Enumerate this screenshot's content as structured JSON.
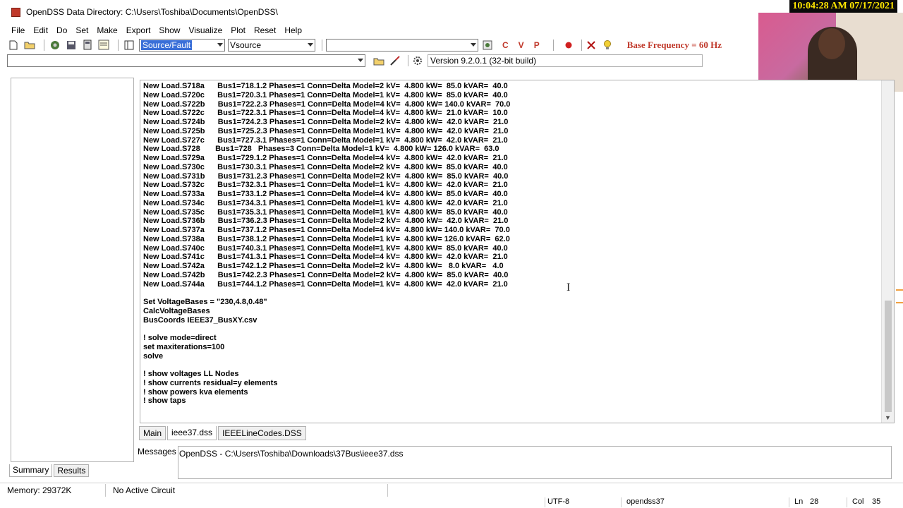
{
  "window": {
    "title": "OpenDSS Data Directory: C:\\Users\\Toshiba\\Documents\\OpenDSS\\"
  },
  "overlay": {
    "clock": "10:04:28 AM 07/17/2021"
  },
  "menu": [
    "File",
    "Edit",
    "Do",
    "Set",
    "Make",
    "Export",
    "Show",
    "Visualize",
    "Plot",
    "Reset",
    "Help"
  ],
  "toolbar": {
    "element_type": "Source/Fault",
    "element_name": "Vsource",
    "element_extra": "",
    "red_buttons": [
      "C",
      "V",
      "P"
    ],
    "base_frequency": "Base Frequency = 60 Hz",
    "command_combo": "",
    "version": "Version 9.2.0.1 (32-bit build)"
  },
  "editor": {
    "lines": [
      "New Load.S718a      Bus1=718.1.2 Phases=1 Conn=Delta Model=2 kV=  4.800 kW=  85.0 kVAR=  40.0",
      "New Load.S720c      Bus1=720.3.1 Phases=1 Conn=Delta Model=1 kV=  4.800 kW=  85.0 kVAR=  40.0",
      "New Load.S722b      Bus1=722.2.3 Phases=1 Conn=Delta Model=4 kV=  4.800 kW= 140.0 kVAR=  70.0",
      "New Load.S722c      Bus1=722.3.1 Phases=1 Conn=Delta Model=4 kV=  4.800 kW=  21.0 kVAR=  10.0",
      "New Load.S724b      Bus1=724.2.3 Phases=1 Conn=Delta Model=2 kV=  4.800 kW=  42.0 kVAR=  21.0",
      "New Load.S725b      Bus1=725.2.3 Phases=1 Conn=Delta Model=1 kV=  4.800 kW=  42.0 kVAR=  21.0",
      "New Load.S727c      Bus1=727.3.1 Phases=1 Conn=Delta Model=1 kV=  4.800 kW=  42.0 kVAR=  21.0",
      "New Load.S728       Bus1=728   Phases=3 Conn=Delta Model=1 kV=  4.800 kW= 126.0 kVAR=  63.0",
      "New Load.S729a      Bus1=729.1.2 Phases=1 Conn=Delta Model=4 kV=  4.800 kW=  42.0 kVAR=  21.0",
      "New Load.S730c      Bus1=730.3.1 Phases=1 Conn=Delta Model=2 kV=  4.800 kW=  85.0 kVAR=  40.0",
      "New Load.S731b      Bus1=731.2.3 Phases=1 Conn=Delta Model=2 kV=  4.800 kW=  85.0 kVAR=  40.0",
      "New Load.S732c      Bus1=732.3.1 Phases=1 Conn=Delta Model=1 kV=  4.800 kW=  42.0 kVAR=  21.0",
      "New Load.S733a      Bus1=733.1.2 Phases=1 Conn=Delta Model=4 kV=  4.800 kW=  85.0 kVAR=  40.0",
      "New Load.S734c      Bus1=734.3.1 Phases=1 Conn=Delta Model=1 kV=  4.800 kW=  42.0 kVAR=  21.0",
      "New Load.S735c      Bus1=735.3.1 Phases=1 Conn=Delta Model=1 kV=  4.800 kW=  85.0 kVAR=  40.0",
      "New Load.S736b      Bus1=736.2.3 Phases=1 Conn=Delta Model=2 kV=  4.800 kW=  42.0 kVAR=  21.0",
      "New Load.S737a      Bus1=737.1.2 Phases=1 Conn=Delta Model=4 kV=  4.800 kW= 140.0 kVAR=  70.0",
      "New Load.S738a      Bus1=738.1.2 Phases=1 Conn=Delta Model=1 kV=  4.800 kW= 126.0 kVAR=  62.0",
      "New Load.S740c      Bus1=740.3.1 Phases=1 Conn=Delta Model=1 kV=  4.800 kW=  85.0 kVAR=  40.0",
      "New Load.S741c      Bus1=741.3.1 Phases=1 Conn=Delta Model=4 kV=  4.800 kW=  42.0 kVAR=  21.0",
      "New Load.S742a      Bus1=742.1.2 Phases=1 Conn=Delta Model=2 kV=  4.800 kW=   8.0 kVAR=   4.0",
      "New Load.S742b      Bus1=742.2.3 Phases=1 Conn=Delta Model=2 kV=  4.800 kW=  85.0 kVAR=  40.0",
      "New Load.S744a      Bus1=744.1.2 Phases=1 Conn=Delta Model=1 kV=  4.800 kW=  42.0 kVAR=  21.0",
      "",
      "Set VoltageBases = \"230,4.8,0.48\"",
      "CalcVoltageBases",
      "BusCoords IEEE37_BusXY.csv",
      "",
      "! solve mode=direct",
      "set maxiterations=100",
      "solve",
      "",
      "! show voltages LL Nodes",
      "! show currents residual=y elements",
      "! show powers kva elements",
      "! show taps"
    ]
  },
  "editor_tabs": [
    "Main",
    "ieee37.dss",
    "IEEELineCodes.DSS"
  ],
  "left_tabs": [
    "Summary",
    "Results"
  ],
  "messages": {
    "label": "Messages",
    "text": "OpenDSS - C:\\Users\\Toshiba\\Downloads\\37Bus\\ieee37.dss"
  },
  "status": {
    "memory": "Memory: 29372K",
    "circuit": "No Active Circuit"
  },
  "bottom": {
    "encoding": "UTF-8",
    "file": "opendss37",
    "ln_label": "Ln",
    "ln": "28",
    "col_label": "Col",
    "col": "35"
  }
}
